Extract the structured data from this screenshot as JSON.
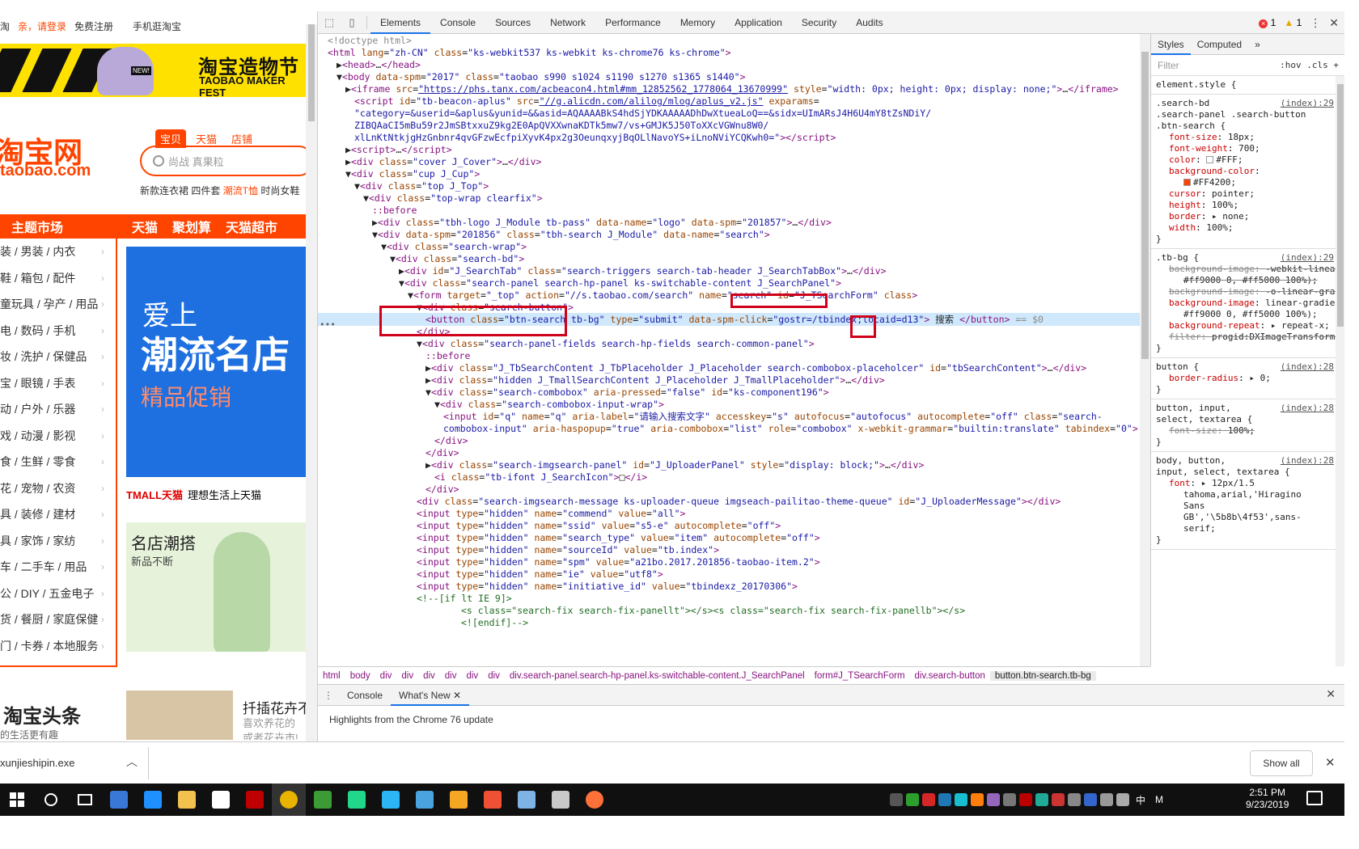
{
  "taobao": {
    "topbar": {
      "home": "淘",
      "login": "亲，请登录",
      "register": "免费注册",
      "mobile": "手机逛淘宝"
    },
    "banner": {
      "title": "淘宝造物节",
      "subtitle": "TAOBAO MAKER FEST",
      "badge": "NEW!"
    },
    "logo": {
      "cn": "淘宝网",
      "en": "taobao.com"
    },
    "search_tabs": [
      "宝贝",
      "天猫",
      "店铺"
    ],
    "search_placeholder": "尚战 真果粒",
    "hot_words": {
      "a": "新款连衣裙 四件套 ",
      "b": "潮流T恤",
      "c": " 时尚女鞋"
    },
    "nav": [
      "主题市场",
      "天猫",
      "聚划算",
      "天猫超市"
    ],
    "categories": [
      "装 / 男装 / 内衣",
      "鞋 / 箱包 / 配件",
      "童玩具 / 孕产 / 用品",
      "电 / 数码 / 手机",
      "妆 / 洗护 / 保健品",
      "宝 / 眼镜 / 手表",
      "动 / 户外 / 乐器",
      "戏 / 动漫 / 影视",
      "食 / 生鲜 / 零食",
      "花 / 宠物 / 农资",
      "具 / 装修 / 建材",
      "具 / 家饰 / 家纺",
      "车 / 二手车 / 用品",
      "公 / DIY / 五金电子",
      "货 / 餐厨 / 家庭保健",
      "门 / 卡券 / 本地服务"
    ],
    "promo": {
      "line1": "爱上",
      "line2": "潮流名店",
      "line3": "精品促销"
    },
    "tmall": {
      "logo": "TMALL天猫",
      "slogan": "理想生活上天猫"
    },
    "fashion": {
      "title": "名店潮搭",
      "subtitle": "新品不断"
    },
    "headline": {
      "title": "淘宝头条",
      "sub": "的生活更有趣",
      "article_title": "扦插花卉不",
      "article_l1": "喜欢养花的",
      "article_l2": "或者花卉市!"
    }
  },
  "devtools": {
    "tabs": [
      "Elements",
      "Console",
      "Sources",
      "Network",
      "Performance",
      "Memory",
      "Application",
      "Security",
      "Audits"
    ],
    "active_tab": "Elements",
    "errors": "1",
    "warnings": "1",
    "dom_lines": [
      {
        "indent": 0,
        "html": "<span class='gray'>&lt;!doctype html&gt;</span>"
      },
      {
        "indent": 0,
        "html": "<span class='tg'>&lt;html</span> <span class='at'>lang</span>=<span class='av'>\"zh-CN\"</span> <span class='at'>class</span>=<span class='av'>\"ks-webkit537 ks-webkit ks-chrome76 ks-chrome\"</span><span class='tg'>&gt;</span>"
      },
      {
        "indent": 1,
        "html": "▶<span class='tg'>&lt;head&gt;</span>…<span class='tg'>&lt;/head&gt;</span>"
      },
      {
        "indent": 1,
        "html": "▼<span class='tg'>&lt;body</span> <span class='at'>data-spm</span>=<span class='av'>\"2017\"</span> <span class='at'>class</span>=<span class='av'>\"taobao s990 s1024 s1190 s1270 s1365 s1440\"</span><span class='tg'>&gt;</span>"
      },
      {
        "indent": 2,
        "html": "▶<span class='tg'>&lt;iframe</span> <span class='at'>src</span>=<span class='lnk'>\"https://phs.tanx.com/acbeacon4.html#mm_12852562_1778064_13670999\"</span> <span class='at'>style</span>=<span class='av'>\"width: 0px; height: 0px; display: none;\"</span><span class='tg'>&gt;</span>…<span class='tg'>&lt;/iframe&gt;</span>"
      },
      {
        "indent": 3,
        "html": "<span class='tg'>&lt;script</span> <span class='at'>id</span>=<span class='av'>\"tb-beacon-aplus\"</span> <span class='at'>src</span>=<span class='lnk'>\"//g.alicdn.com/alilog/mlog/aplus_v2.js\"</span> <span class='at'>exparams</span>="
      },
      {
        "indent": 3,
        "html": "<span class='av'>\"category=&amp;userid=&amp;aplus&amp;yunid=&amp;&amp;asid=AQAAAABkS4hdSjYDKAAAAADhDwXtueaLoQ==&amp;sidx=UImARsJ4H6U4mY8tZsNDiY/</span>"
      },
      {
        "indent": 3,
        "html": "<span class='av'>ZIBQAaCI5mBu59r2JmSBtxxuZ9kg2E0ApQVXXwnaKDTk5mw7/vs+GMJK5J50ToXXcVGWnu8W0/</span>"
      },
      {
        "indent": 3,
        "html": "<span class='av'>xlLnKtNtkjgHzGnbnr4qvGFzwEcfpiXyvK4px2g3OeunqxyjBqOLlNavoYS+iLnoNViYCQKwh0=\"</span><span class='tg'>&gt;&lt;/script&gt;</span>"
      },
      {
        "indent": 2,
        "html": "▶<span class='tg'>&lt;script&gt;</span>…<span class='tg'>&lt;/script&gt;</span>"
      },
      {
        "indent": 2,
        "html": "▶<span class='tg'>&lt;div</span> <span class='at'>class</span>=<span class='av'>\"cover J_Cover\"</span><span class='tg'>&gt;</span>…<span class='tg'>&lt;/div&gt;</span>"
      },
      {
        "indent": 2,
        "html": "▼<span class='tg'>&lt;div</span> <span class='at'>class</span>=<span class='av'>\"cup J_Cup\"</span><span class='tg'>&gt;</span>"
      },
      {
        "indent": 3,
        "html": "▼<span class='tg'>&lt;div</span> <span class='at'>class</span>=<span class='av'>\"top J_Top\"</span><span class='tg'>&gt;</span>"
      },
      {
        "indent": 4,
        "html": "▼<span class='tg'>&lt;div</span> <span class='at'>class</span>=<span class='av'>\"top-wrap clearfix\"</span><span class='tg'>&gt;</span>"
      },
      {
        "indent": 5,
        "html": "<span class='ps'>::before</span>"
      },
      {
        "indent": 5,
        "html": "▶<span class='tg'>&lt;div</span> <span class='at'>class</span>=<span class='av'>\"tbh-logo J_Module tb-pass\"</span> <span class='at'>data-name</span>=<span class='av'>\"logo\"</span> <span class='at'>data-spm</span>=<span class='av'>\"201857\"</span><span class='tg'>&gt;</span>…<span class='tg'>&lt;/div&gt;</span>"
      },
      {
        "indent": 5,
        "html": "▼<span class='tg'>&lt;div</span> <span class='at'>data-spm</span>=<span class='av'>\"201856\"</span> <span class='at'>class</span>=<span class='av'>\"tbh-search J_Module\"</span> <span class='at'>data-name</span>=<span class='av'>\"search\"</span><span class='tg'>&gt;</span>"
      },
      {
        "indent": 6,
        "html": "▼<span class='tg'>&lt;div</span> <span class='at'>class</span>=<span class='av'>\"search-wrap\"</span><span class='tg'>&gt;</span>"
      },
      {
        "indent": 7,
        "html": "▼<span class='tg'>&lt;div</span> <span class='at'>class</span>=<span class='av'>\"search-bd\"</span><span class='tg'>&gt;</span>"
      },
      {
        "indent": 8,
        "html": "▶<span class='tg'>&lt;div</span> <span class='at'>id</span>=<span class='av'>\"J_SearchTab\"</span> <span class='at'>class</span>=<span class='av'>\"search-triggers search-tab-header J_SearchTabBox\"</span><span class='tg'>&gt;</span>…<span class='tg'>&lt;/div&gt;</span>"
      },
      {
        "indent": 8,
        "html": "▼<span class='tg'>&lt;div</span> <span class='at'>class</span>=<span class='av'>\"search-panel search-hp-panel ks-switchable-content J_SearchPanel\"</span><span class='tg'>&gt;</span>"
      },
      {
        "indent": 9,
        "html": "▼<span class='tg'>&lt;form</span> <span class='at'>target</span>=<span class='av'>\"_top\"</span> <span class='at'>action</span>=<span class='av'>\"//s.taobao.com/search\"</span> <span class='at'>name</span>=<span class='av'>\"search\"</span> <span class='at'>id</span>=<span class='av'>\"J_TSearchForm\"</span> <span class='at'>class</span><span class='tg'>&gt;</span>"
      },
      {
        "indent": 10,
        "html": "▼<span class='tg'>&lt;div</span> <span class='at'>class</span>=<span class='av'>\"search-button\"</span><span class='tg'>&gt;</span>"
      },
      {
        "indent": 11,
        "html": "<span class='tg'>&lt;button</span> <span class='at'>class</span>=<span class='av'>\"btn-search tb-bg\"</span> <span class='at'>type</span>=<span class='av'>\"submit\"</span> <span class='at'>data-spm-click</span>=<span class='av'>\"gostr=/tbindex;locaid=d13\"</span><span class='tg'>&gt;</span> 搜索 <span class='tg'>&lt;/button&gt;</span> <span class='gray'>== $0</span>"
      },
      {
        "indent": 10,
        "html": "<span class='tg'>&lt;/div&gt;</span>"
      },
      {
        "indent": 10,
        "html": "▼<span class='tg'>&lt;div</span> <span class='at'>class</span>=<span class='av'>\"search-panel-fields search-hp-fields search-common-panel\"</span><span class='tg'>&gt;</span>"
      },
      {
        "indent": 11,
        "html": "<span class='ps'>::before</span>"
      },
      {
        "indent": 11,
        "html": "▶<span class='tg'>&lt;div</span> <span class='at'>class</span>=<span class='av'>\"J_TbSearchContent J_TbPlaceholder J_Placeholder search-combobox-placeholcer\"</span> <span class='at'>id</span>=<span class='av'>\"tbSearchContent\"</span><span class='tg'>&gt;</span>…<span class='tg'>&lt;/div&gt;</span>"
      },
      {
        "indent": 11,
        "html": "▶<span class='tg'>&lt;div</span> <span class='at'>class</span>=<span class='av'>\"hidden J_TmallSearchContent J_Placeholder J_TmallPlaceholder\"</span><span class='tg'>&gt;</span>…<span class='tg'>&lt;/div&gt;</span>"
      },
      {
        "indent": 11,
        "html": "▼<span class='tg'>&lt;div</span> <span class='at'>class</span>=<span class='av'>\"search-combobox\"</span> <span class='at'>aria-pressed</span>=<span class='av'>\"false\"</span> <span class='at'>id</span>=<span class='av'>\"ks-component196\"</span><span class='tg'>&gt;</span>"
      },
      {
        "indent": 12,
        "html": "▼<span class='tg'>&lt;div</span> <span class='at'>class</span>=<span class='av'>\"search-combobox-input-wrap\"</span><span class='tg'>&gt;</span>"
      },
      {
        "indent": 13,
        "html": "<span class='tg'>&lt;input</span> <span class='at'>id</span>=<span class='av'>\"q\"</span> <span class='at'>name</span>=<span class='av'>\"q\"</span> <span class='at'>aria-label</span>=<span class='av'>\"请输入搜索文字\"</span> <span class='at'>accesskey</span>=<span class='av'>\"s\"</span> <span class='at'>autofocus</span>=<span class='av'>\"autofocus\"</span> <span class='at'>autocomplete</span>=<span class='av'>\"off\"</span> <span class='at'>class</span>=<span class='av'>\"search-</span>"
      },
      {
        "indent": 13,
        "html": "<span class='av'>combobox-input\"</span> <span class='at'>aria-haspopup</span>=<span class='av'>\"true\"</span> <span class='at'>aria-combobox</span>=<span class='av'>\"list\"</span> <span class='at'>role</span>=<span class='av'>\"combobox\"</span> <span class='at'>x-webkit-grammar</span>=<span class='av'>\"builtin:translate\"</span> <span class='at'>tabindex</span>=<span class='av'>\"0\"</span><span class='tg'>&gt;</span>"
      },
      {
        "indent": 12,
        "html": "<span class='tg'>&lt;/div&gt;</span>"
      },
      {
        "indent": 11,
        "html": "<span class='tg'>&lt;/div&gt;</span>"
      },
      {
        "indent": 11,
        "html": "▶<span class='tg'>&lt;div</span> <span class='at'>class</span>=<span class='av'>\"search-imgsearch-panel\"</span> <span class='at'>id</span>=<span class='av'>\"J_UploaderPanel\"</span> <span class='at'>style</span>=<span class='av'>\"display: block;\"</span><span class='tg'>&gt;</span>…<span class='tg'>&lt;/div&gt;</span>"
      },
      {
        "indent": 12,
        "html": "<span class='tg'>&lt;i</span> <span class='at'>class</span>=<span class='av'>\"tb-ifont J_SearchIcon\"</span><span class='tg'>&gt;</span>□<span class='tg'>&lt;/i&gt;</span>"
      },
      {
        "indent": 11,
        "html": "<span class='tg'>&lt;/div&gt;</span>"
      },
      {
        "indent": 10,
        "html": "<span class='tg'>&lt;div</span> <span class='at'>class</span>=<span class='av'>\"search-imgsearch-message ks-uploader-queue imgseach-pailitao-theme-queue\"</span> <span class='at'>id</span>=<span class='av'>\"J_UploaderMessage\"</span><span class='tg'>&gt;&lt;/div&gt;</span>"
      },
      {
        "indent": 10,
        "html": "<span class='tg'>&lt;input</span> <span class='at'>type</span>=<span class='av'>\"hidden\"</span> <span class='at'>name</span>=<span class='av'>\"commend\"</span> <span class='at'>value</span>=<span class='av'>\"all\"</span><span class='tg'>&gt;</span>"
      },
      {
        "indent": 10,
        "html": "<span class='tg'>&lt;input</span> <span class='at'>type</span>=<span class='av'>\"hidden\"</span> <span class='at'>name</span>=<span class='av'>\"ssid\"</span> <span class='at'>value</span>=<span class='av'>\"s5-e\"</span> <span class='at'>autocomplete</span>=<span class='av'>\"off\"</span><span class='tg'>&gt;</span>"
      },
      {
        "indent": 10,
        "html": "<span class='tg'>&lt;input</span> <span class='at'>type</span>=<span class='av'>\"hidden\"</span> <span class='at'>name</span>=<span class='av'>\"search_type\"</span> <span class='at'>value</span>=<span class='av'>\"item\"</span> <span class='at'>autocomplete</span>=<span class='av'>\"off\"</span><span class='tg'>&gt;</span>"
      },
      {
        "indent": 10,
        "html": "<span class='tg'>&lt;input</span> <span class='at'>type</span>=<span class='av'>\"hidden\"</span> <span class='at'>name</span>=<span class='av'>\"sourceId\"</span> <span class='at'>value</span>=<span class='av'>\"tb.index\"</span><span class='tg'>&gt;</span>"
      },
      {
        "indent": 10,
        "html": "<span class='tg'>&lt;input</span> <span class='at'>type</span>=<span class='av'>\"hidden\"</span> <span class='at'>name</span>=<span class='av'>\"spm\"</span> <span class='at'>value</span>=<span class='av'>\"a21bo.2017.201856-taobao-item.2\"</span><span class='tg'>&gt;</span>"
      },
      {
        "indent": 10,
        "html": "<span class='tg'>&lt;input</span> <span class='at'>type</span>=<span class='av'>\"hidden\"</span> <span class='at'>name</span>=<span class='av'>\"ie\"</span> <span class='at'>value</span>=<span class='av'>\"utf8\"</span><span class='tg'>&gt;</span>"
      },
      {
        "indent": 10,
        "html": "<span class='tg'>&lt;input</span> <span class='at'>type</span>=<span class='av'>\"hidden\"</span> <span class='at'>name</span>=<span class='av'>\"initiative_id\"</span> <span class='at'>value</span>=<span class='av'>\"tbindexz_20170306\"</span><span class='tg'>&gt;</span>"
      },
      {
        "indent": 10,
        "html": "<span class='cm'>&lt;!--[if lt IE 9]&gt;</span>"
      },
      {
        "indent": 15,
        "html": "<span class='cm'>&lt;s class=\"search-fix search-fix-panellt\"&gt;&lt;/s&gt;&lt;s class=\"search-fix search-fix-panellb\"&gt;&lt;/s&gt;</span>"
      },
      {
        "indent": 15,
        "html": "<span class='cm'>&lt;![endif]--&gt;</span>"
      }
    ],
    "selected_line": 23,
    "breadcrumbs": [
      "html",
      "body",
      "div",
      "div",
      "div",
      "div",
      "div",
      "div",
      "div.search-panel.search-hp-panel.ks-switchable-content.J_SearchPanel",
      "form#J_TSearchForm",
      "div.search-button",
      "button.btn-search.tb-bg"
    ],
    "styles_tabs": [
      "Styles",
      "Computed"
    ],
    "filter_placeholder": "Filter",
    "filter_tools": ":hov .cls +",
    "drawer_tabs": [
      "Console",
      "What's New"
    ],
    "drawer_message": "Highlights from the Chrome 76 update"
  },
  "styles_rules": [
    {
      "selector": "element.style {",
      "source": "",
      "props": []
    },
    {
      "selector": ".search-bd\n.search-panel .search-button\n.btn-search {",
      "source": "(index):29",
      "props": [
        {
          "n": "font-size",
          "v": "18px;"
        },
        {
          "n": "font-weight",
          "v": "700;"
        },
        {
          "n": "color",
          "v": "#FFF;",
          "sw": "#FFFFFF"
        },
        {
          "n": "background-color",
          "v": ""
        },
        {
          "n": "",
          "v": "#FF4200;",
          "sw": "#FF4200"
        },
        {
          "n": "cursor",
          "v": "pointer;"
        },
        {
          "n": "height",
          "v": "100%;"
        },
        {
          "n": "border",
          "v": "▸ none;"
        },
        {
          "n": "width",
          "v": "100%;"
        }
      ]
    },
    {
      "selector": ".tb-bg {",
      "source": "(index):29",
      "props": [
        {
          "n": "background-image",
          "v": "-webkit-linear-gradient(left,",
          "strike": true
        },
        {
          "n": "",
          "v": "#ff9000 0, #ff5000 100%);",
          "strike": true
        },
        {
          "n": "background-image",
          "v": "-o-linear-gradient(left,#ff9000 0,#ff5000 100%);",
          "strike": true
        },
        {
          "n": "background-image",
          "v": "linear-gradient(to right,"
        },
        {
          "n": "",
          "v": "#ff9000 0, #ff5000 100%);"
        },
        {
          "n": "background-repeat",
          "v": "▸ repeat-x;"
        },
        {
          "n": "filter",
          "v": "progid:DXImageTransform.",
          "strike": true
        }
      ]
    },
    {
      "selector": "button {",
      "source": "(index):28",
      "props": [
        {
          "n": "border-radius",
          "v": "▸ 0;"
        }
      ]
    },
    {
      "selector": "button, input,\nselect, textarea {",
      "source": "(index):28",
      "props": [
        {
          "n": "font-size",
          "v": "100%;",
          "strike": true
        }
      ]
    },
    {
      "selector": "body, button,\ninput, select, textarea {",
      "source": "(index):28",
      "props": [
        {
          "n": "font",
          "v": "▸ 12px/1.5"
        },
        {
          "n": "",
          "v": "tahoma,arial,'Hiragino"
        },
        {
          "n": "",
          "v": "Sans"
        },
        {
          "n": "",
          "v": "GB','\\5b8b\\4f53',sans-"
        },
        {
          "n": "",
          "v": "serif;"
        }
      ]
    }
  ],
  "downloads": {
    "file": "xunjieshipin.exe",
    "show_all": "Show all"
  },
  "taskbar": {
    "icons": [
      "start-icon",
      "search-circle-icon",
      "task-view-icon",
      "network-app-icon",
      "edge-icon",
      "file-explorer-icon",
      "store-icon",
      "filezilla-icon",
      "chrome-icon",
      "notepad-icon",
      "pycharm-icon",
      "player-icon",
      "app-icon",
      "calendar-app-icon",
      "git-icon",
      "paint-icon",
      "installer-icon",
      "firefox-icon"
    ],
    "tray_lang": "中",
    "tray_m": "M",
    "time": "2:51 PM",
    "date": "9/23/2019"
  }
}
